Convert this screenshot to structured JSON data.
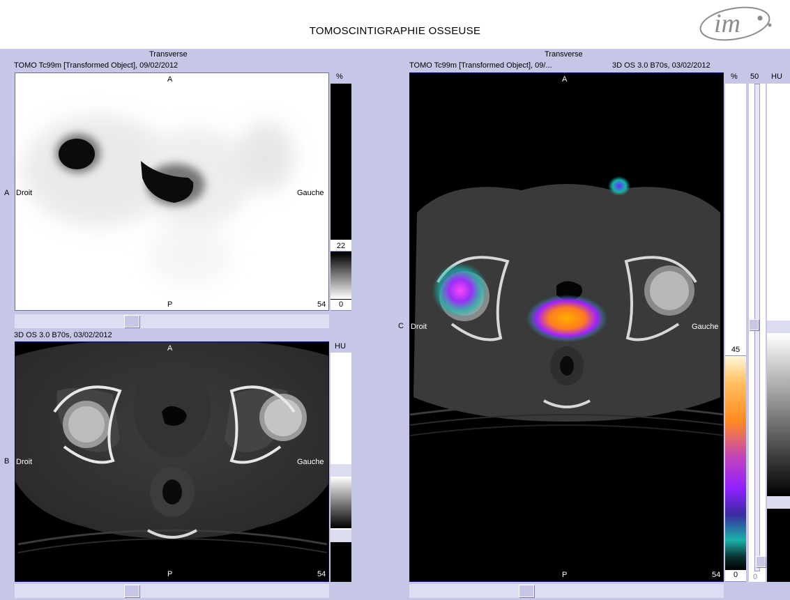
{
  "header": {
    "title": "TOMOSCINTIGRAPHIE OSSEUSE",
    "logo_text": "im"
  },
  "panel_a": {
    "view_title": "Transverse",
    "series": "TOMO Tc99m [Transformed Object], 09/02/2012",
    "row_label": "A",
    "orient_top": "A",
    "orient_bottom": "P",
    "orient_left": "Droit",
    "orient_right": "Gauche",
    "slice": "54",
    "scale_unit": "%",
    "scale_max": "22",
    "scale_min": "0"
  },
  "panel_b": {
    "series": "3D OS  3.0  B70s, 03/02/2012",
    "row_label": "B",
    "orient_top": "A",
    "orient_bottom": "P",
    "orient_left": "Droit",
    "orient_right": "Gauche",
    "slice": "54",
    "scale_unit": "HU"
  },
  "panel_c": {
    "view_title": "Transverse",
    "series_left": "TOMO Tc99m [Transformed Object], 09/...",
    "series_right": "3D OS  3.0  B70s, 03/02/2012",
    "row_label": "C",
    "orient_top": "A",
    "orient_bottom": "P",
    "orient_left": "Droit",
    "orient_right": "Gauche",
    "slice": "54",
    "pct_unit": "%",
    "pct_max": "45",
    "pct_min": "0",
    "fusion_top": "50",
    "fusion_bottom": "0",
    "hu_unit": "HU"
  },
  "colors": {
    "workspace_bg": "#c6c6e6",
    "viewport_border": "#0000aa",
    "ct_bone": "#e8e8e8",
    "pet_hot": "#ff9a00",
    "pet_mid": "#9b22ff",
    "pet_low": "#19b2a8"
  }
}
